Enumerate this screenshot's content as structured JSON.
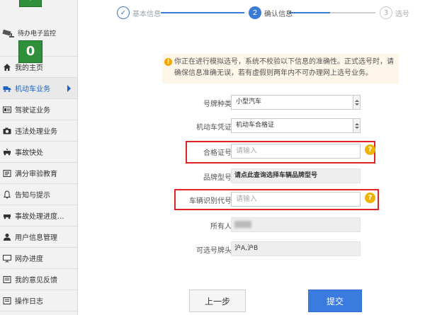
{
  "sidebar": {
    "top_count": "0",
    "monitor_label": "待办电子监控",
    "monitor_count": "0",
    "items": [
      {
        "label": "我的主页",
        "icon": "home-icon"
      },
      {
        "label": "机动车业务",
        "icon": "truck-icon",
        "active": true
      },
      {
        "label": "驾驶证业务",
        "icon": "id-card-icon"
      },
      {
        "label": "违法处理业务",
        "icon": "camera-icon"
      },
      {
        "label": "事故快处",
        "icon": "accident-icon"
      },
      {
        "label": "满分审验教育",
        "icon": "education-icon"
      },
      {
        "label": "告知与提示",
        "icon": "bell-icon"
      },
      {
        "label": "事故处理进度...",
        "icon": "progress-icon"
      },
      {
        "label": "用户信息管理",
        "icon": "user-icon"
      },
      {
        "label": "网办进度",
        "icon": "monitor-icon"
      },
      {
        "label": "我的意见反馈",
        "icon": "feedback-icon"
      },
      {
        "label": "操作日志",
        "icon": "log-icon"
      }
    ]
  },
  "steps": [
    {
      "num": "✓",
      "label": "基本信息"
    },
    {
      "num": "2",
      "label": "确认信息"
    },
    {
      "num": "3",
      "label": "选号"
    }
  ],
  "warning": {
    "text": "你正在进行模拟选号，系统不校验以下信息的准确性。正式选号时，请确保信息准确无误，若有虚假则两年内不可办理网上选号业务。"
  },
  "form": {
    "plate_type_label": "号牌种类",
    "plate_type_value": "小型汽车",
    "vehicle_doc_label": "机动车凭证",
    "vehicle_doc_value": "机动车合格证",
    "cert_no_label": "合格证号",
    "cert_no_placeholder": "请输入",
    "brand_model_label": "品牌型号",
    "brand_model_value": "请点此查询选择车辆品牌型号",
    "vin_label": "车辆识别代号",
    "vin_placeholder": "请输入",
    "owner_label": "所有人",
    "plate_prefix_label": "可选号牌头",
    "plate_prefix_value": "沪A,沪B",
    "help_glyph": "?"
  },
  "buttons": {
    "prev": "上一步",
    "submit": "提交"
  },
  "colors": {
    "accent": "#3a7bd5",
    "warning_bg": "#fef6e8",
    "help": "#f0b400",
    "highlight": "#e02424",
    "green_badge": "#2f8f3b"
  }
}
